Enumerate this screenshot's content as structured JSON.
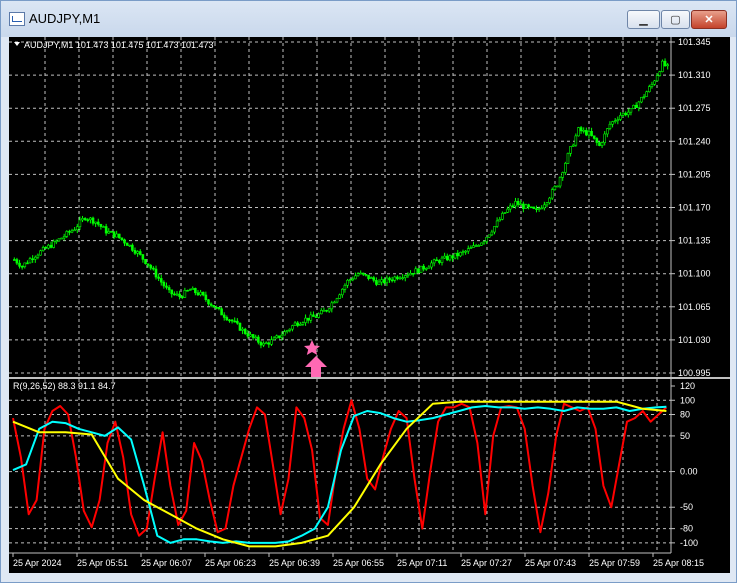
{
  "window": {
    "title": "AUDJPY,M1",
    "buttons": {
      "minimize": "▁",
      "maximize": "▢",
      "close": "✕"
    }
  },
  "price_header": "AUDJPY,M1  101.473 101.475 101.473 101.473",
  "indicator_header": "R(9,26,52) 88.3 91.1 84.7",
  "colors": {
    "background": "#000000",
    "grid": "#c0c0c0",
    "candles": "#00ff00",
    "fast_line": "#ff0000",
    "mid_line": "#00ffff",
    "slow_line": "#ffff00",
    "signal_marker": "#ff69b4"
  },
  "signal": {
    "icon": "star-icon",
    "arrow": "up-arrow-icon",
    "at": "25 Apr 06:45"
  },
  "chart_data": [
    {
      "type": "candlestick",
      "symbol": "AUDJPY",
      "timeframe": "M1",
      "yticks": [
        "101.345",
        "101.310",
        "101.275",
        "101.240",
        "101.205",
        "101.170",
        "101.135",
        "101.100",
        "101.065",
        "101.030",
        "100.995"
      ],
      "ylim": [
        100.995,
        101.345
      ],
      "grid": true,
      "close_path": [
        [
          0,
          101.115
        ],
        [
          3,
          101.108
        ],
        [
          7,
          101.118
        ],
        [
          11,
          101.125
        ],
        [
          15,
          101.132
        ],
        [
          19,
          101.14
        ],
        [
          23,
          101.148
        ],
        [
          27,
          101.16
        ],
        [
          31,
          101.155
        ],
        [
          35,
          101.145
        ],
        [
          39,
          101.14
        ],
        [
          43,
          101.132
        ],
        [
          47,
          101.122
        ],
        [
          51,
          101.11
        ],
        [
          55,
          101.095
        ],
        [
          59,
          101.08
        ],
        [
          63,
          101.076
        ],
        [
          67,
          101.083
        ],
        [
          71,
          101.078
        ],
        [
          75,
          101.068
        ],
        [
          79,
          101.058
        ],
        [
          83,
          101.05
        ],
        [
          87,
          101.04
        ],
        [
          91,
          101.032
        ],
        [
          95,
          101.025
        ],
        [
          99,
          101.03
        ],
        [
          103,
          101.038
        ],
        [
          107,
          101.047
        ],
        [
          111,
          101.052
        ],
        [
          115,
          101.055
        ],
        [
          119,
          101.062
        ],
        [
          123,
          101.076
        ],
        [
          127,
          101.092
        ],
        [
          131,
          101.1
        ],
        [
          135,
          101.096
        ],
        [
          139,
          101.09
        ],
        [
          143,
          101.094
        ],
        [
          147,
          101.098
        ],
        [
          151,
          101.101
        ],
        [
          155,
          101.105
        ],
        [
          159,
          101.111
        ],
        [
          163,
          101.115
        ],
        [
          167,
          101.118
        ],
        [
          171,
          101.122
        ],
        [
          175,
          101.128
        ],
        [
          179,
          101.136
        ],
        [
          183,
          101.15
        ],
        [
          187,
          101.165
        ],
        [
          191,
          101.175
        ],
        [
          195,
          101.17
        ],
        [
          199,
          101.166
        ],
        [
          203,
          101.178
        ],
        [
          207,
          101.195
        ],
        [
          211,
          101.225
        ],
        [
          215,
          101.252
        ],
        [
          219,
          101.248
        ],
        [
          223,
          101.235
        ],
        [
          227,
          101.258
        ],
        [
          231,
          101.268
        ],
        [
          235,
          101.272
        ],
        [
          239,
          101.285
        ],
        [
          243,
          101.3
        ],
        [
          247,
          101.322
        ],
        [
          250,
          101.316
        ]
      ],
      "n_candles": 250
    },
    {
      "type": "line",
      "title": "R(9,26,52)",
      "values_label": "88.3 91.1 84.7",
      "ylim": [
        -110,
        120
      ],
      "yticks": [
        "120",
        "100",
        "80",
        "50",
        "0.00",
        "-50",
        "-80",
        "-100"
      ],
      "series": [
        {
          "name": "9",
          "color": "#ff0000",
          "x": [
            0,
            3,
            6,
            9,
            12,
            15,
            18,
            21,
            24,
            27,
            30,
            33,
            36,
            39,
            42,
            45,
            48,
            51,
            54,
            57,
            60,
            63,
            66,
            69,
            72,
            75,
            78,
            81,
            84,
            87,
            90,
            93,
            96,
            99,
            102,
            105,
            108,
            111,
            114,
            117,
            120,
            123,
            126,
            129,
            132,
            135,
            138,
            141,
            144,
            147,
            150,
            153,
            156,
            159,
            162,
            165,
            168,
            171,
            174,
            177,
            180,
            183,
            186,
            189,
            192,
            195,
            198,
            201,
            204,
            207,
            210,
            213,
            216,
            219,
            222,
            225,
            228,
            231,
            234,
            237,
            240,
            243,
            246,
            249
          ],
          "values": [
            75,
            20,
            -60,
            -40,
            60,
            85,
            92,
            80,
            20,
            -55,
            -78,
            -40,
            40,
            70,
            20,
            -60,
            -90,
            -80,
            -10,
            55,
            -20,
            -75,
            -55,
            40,
            15,
            -40,
            -85,
            -80,
            -20,
            20,
            60,
            90,
            80,
            10,
            -60,
            -10,
            90,
            75,
            30,
            -65,
            -75,
            0,
            60,
            100,
            60,
            -10,
            -25,
            20,
            60,
            85,
            75,
            -10,
            -80,
            0,
            70,
            90,
            90,
            95,
            90,
            40,
            -60,
            50,
            90,
            92,
            90,
            60,
            -20,
            -85,
            -30,
            50,
            95,
            90,
            85,
            90,
            60,
            -20,
            -50,
            10,
            70,
            75,
            85,
            70,
            80,
            90
          ]
        },
        {
          "name": "26",
          "color": "#00ffff",
          "x": [
            0,
            5,
            10,
            15,
            20,
            25,
            30,
            35,
            40,
            45,
            50,
            55,
            60,
            65,
            70,
            75,
            80,
            85,
            90,
            95,
            100,
            105,
            110,
            115,
            120,
            125,
            130,
            135,
            140,
            145,
            150,
            155,
            160,
            165,
            170,
            175,
            180,
            185,
            190,
            195,
            200,
            205,
            210,
            215,
            220,
            225,
            230,
            235,
            240,
            245,
            249
          ],
          "values": [
            2,
            10,
            60,
            70,
            68,
            60,
            55,
            50,
            62,
            45,
            -20,
            -90,
            -100,
            -95,
            -95,
            -98,
            -100,
            -98,
            -100,
            -100,
            -100,
            -98,
            -90,
            -80,
            -50,
            30,
            78,
            85,
            82,
            75,
            70,
            72,
            75,
            80,
            85,
            90,
            92,
            90,
            90,
            88,
            90,
            88,
            85,
            90,
            88,
            88,
            90,
            85,
            88,
            90,
            91
          ]
        },
        {
          "name": "52",
          "color": "#ffff00",
          "x": [
            0,
            10,
            20,
            30,
            40,
            50,
            60,
            70,
            80,
            90,
            100,
            110,
            120,
            130,
            140,
            150,
            160,
            170,
            180,
            190,
            200,
            210,
            220,
            230,
            240,
            249
          ],
          "values": [
            70,
            55,
            55,
            52,
            -10,
            -40,
            -60,
            -80,
            -95,
            -105,
            -105,
            -100,
            -90,
            -50,
            10,
            60,
            95,
            98,
            98,
            98,
            98,
            98,
            98,
            98,
            88,
            85
          ]
        }
      ]
    }
  ],
  "time_axis": [
    "25 Apr 2024",
    "25 Apr 05:51",
    "25 Apr 06:07",
    "25 Apr 06:23",
    "25 Apr 06:39",
    "25 Apr 06:55",
    "25 Apr 07:11",
    "25 Apr 07:27",
    "25 Apr 07:43",
    "25 Apr 07:59",
    "25 Apr 08:15"
  ]
}
